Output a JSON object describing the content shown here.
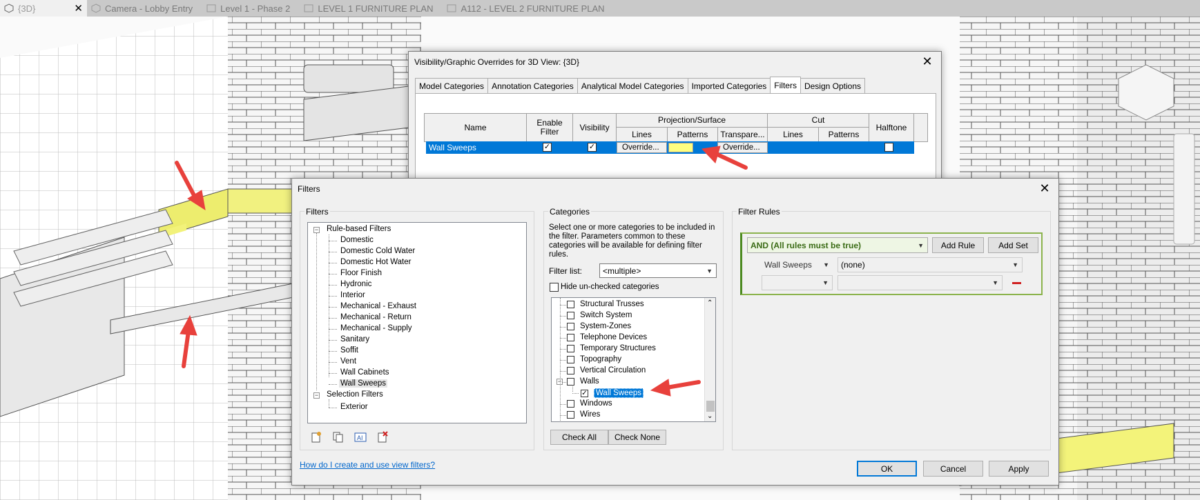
{
  "view_tabs": [
    {
      "label": "{3D}",
      "active": true
    },
    {
      "label": "Camera - Lobby Entry"
    },
    {
      "label": "Level 1 - Phase 2"
    },
    {
      "label": "LEVEL 1 FURNITURE PLAN"
    },
    {
      "label": "A112 - LEVEL 2 FURNITURE PLAN"
    }
  ],
  "vg_dialog": {
    "title": "Visibility/Graphic Overrides for 3D View: {3D}",
    "tabs": [
      "Model Categories",
      "Annotation Categories",
      "Analytical Model Categories",
      "Imported Categories",
      "Filters",
      "Design Options"
    ],
    "selected_tab": "Filters",
    "headers": {
      "name": "Name",
      "enable": "Enable\nFilter",
      "visibility": "Visibility",
      "proj": "Projection/Surface",
      "lines": "Lines",
      "patterns": "Patterns",
      "transp": "Transpare...",
      "cut": "Cut",
      "cut_lines": "Lines",
      "cut_patterns": "Patterns",
      "halftone": "Halftone"
    },
    "row": {
      "name": "Wall Sweeps",
      "enable": true,
      "visibility": true,
      "lines": "Override...",
      "pattern_color": "#ffff80",
      "transp": "Override...",
      "halftone": false
    }
  },
  "filters_dialog": {
    "title": "Filters",
    "filters_label": "Filters",
    "tree": {
      "rule_based": "Rule-based Filters",
      "items": [
        "Domestic",
        "Domestic Cold Water",
        "Domestic Hot Water",
        "Floor Finish",
        "Hydronic",
        "Interior",
        "Mechanical - Exhaust",
        "Mechanical - Return",
        "Mechanical - Supply",
        "Sanitary",
        "Soffit",
        "Vent",
        "Wall Cabinets",
        "Wall Sweeps"
      ],
      "selected": "Wall Sweeps",
      "selection": "Selection Filters",
      "selection_items": [
        "Exterior"
      ]
    },
    "categories_label": "Categories",
    "categories_desc": "Select one or more categories to be included in the filter.  Parameters common to these categories will be available for defining filter rules.",
    "filter_list_label": "Filter list:",
    "filter_list_value": "<multiple>",
    "hide_unchecked": "Hide un-checked categories",
    "categories": [
      {
        "label": "Structural Trusses",
        "checked": false
      },
      {
        "label": "Switch System",
        "checked": false
      },
      {
        "label": "System-Zones",
        "checked": false
      },
      {
        "label": "Telephone Devices",
        "checked": false
      },
      {
        "label": "Temporary Structures",
        "checked": false
      },
      {
        "label": "Topography",
        "checked": false
      },
      {
        "label": "Vertical Circulation",
        "checked": false
      },
      {
        "label": "Walls",
        "checked": false
      },
      {
        "label": "Wall Sweeps",
        "checked": true
      },
      {
        "label": "Windows",
        "checked": false
      },
      {
        "label": "Wires",
        "checked": false
      }
    ],
    "check_all": "Check All",
    "check_none": "Check None",
    "rules_label": "Filter Rules",
    "rule_combo": "AND (All rules must be true)",
    "add_rule": "Add Rule",
    "add_set": "Add Set",
    "rule_param": "Wall Sweeps",
    "rule_value": "(none)",
    "help_link": "How do I create and use view filters?",
    "ok": "OK",
    "cancel": "Cancel",
    "apply": "Apply"
  },
  "colors": {
    "accent": "#0078d7",
    "highlight_yellow": "#ffff80",
    "arrow_red": "#e8413c"
  }
}
